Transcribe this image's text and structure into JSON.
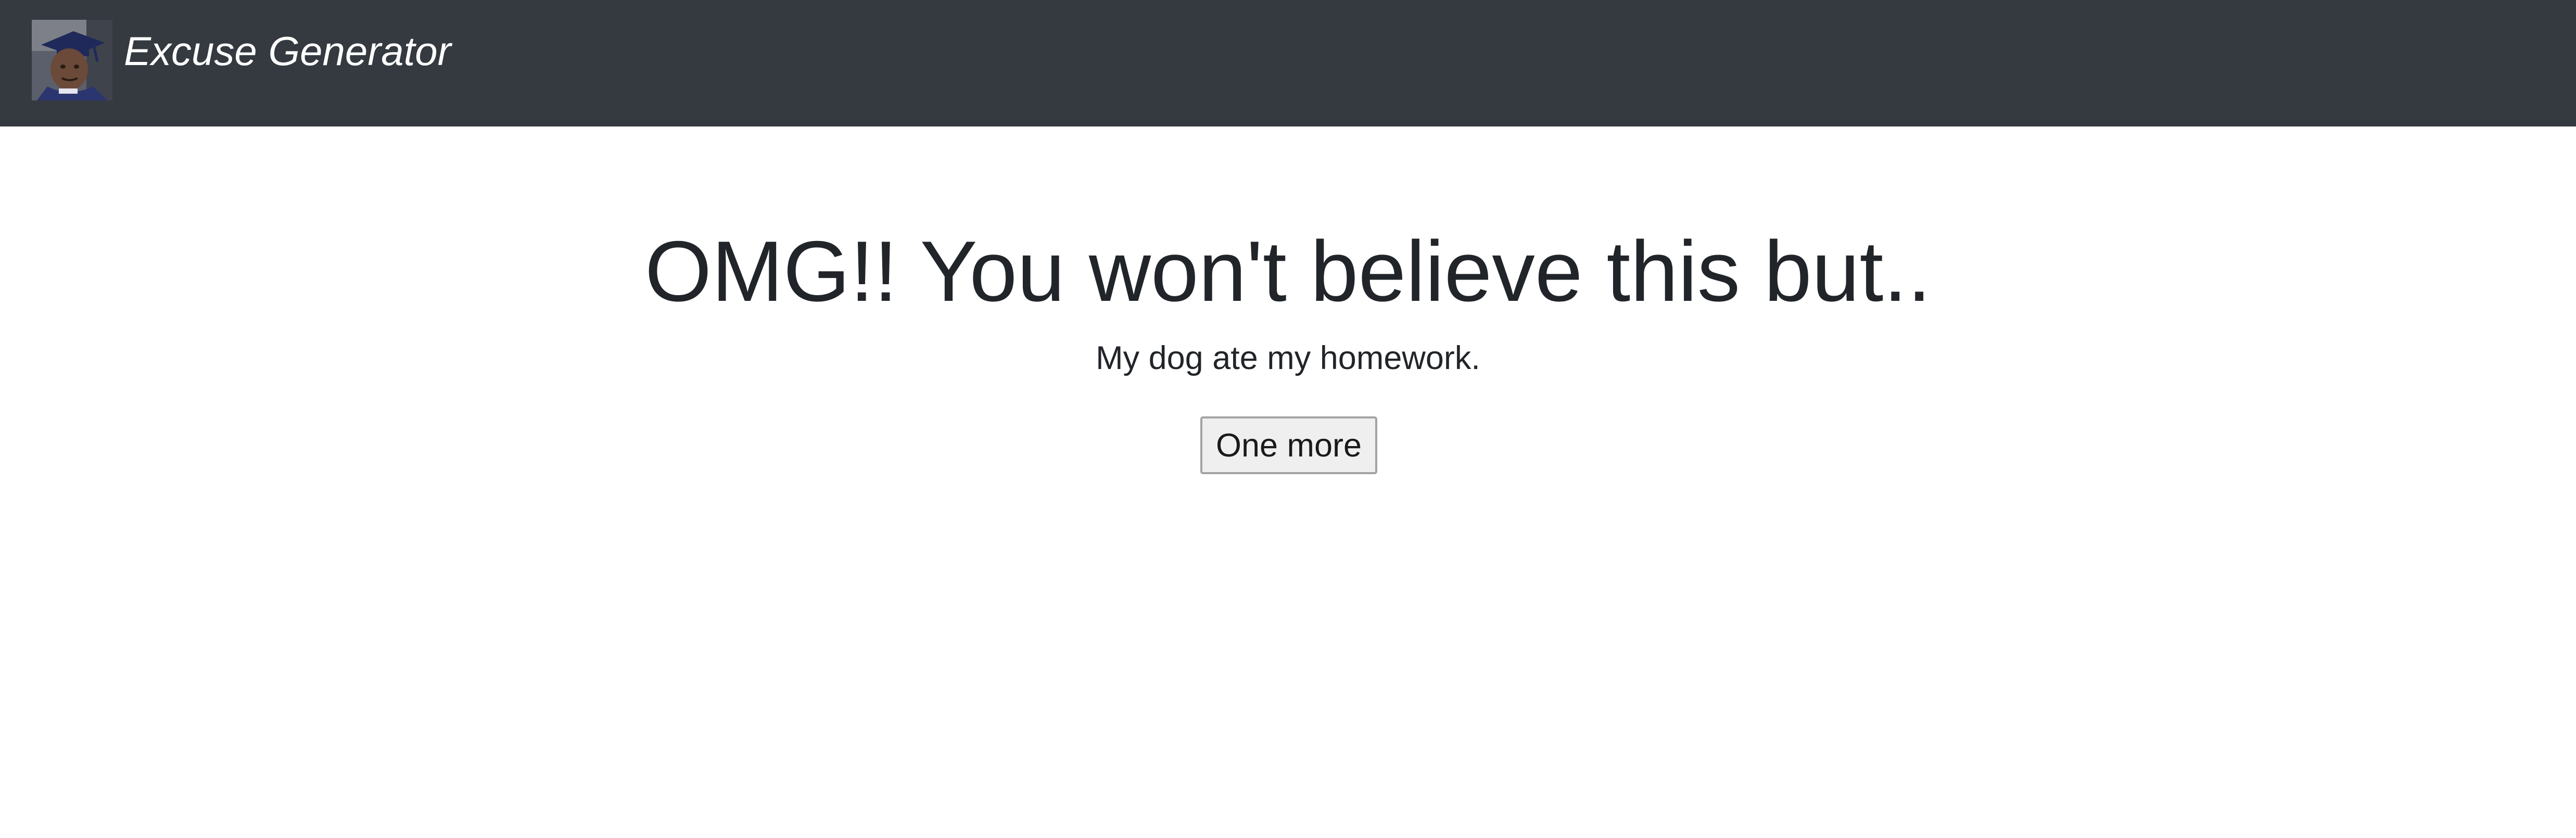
{
  "navbar": {
    "brand_name": "Excuse Generator",
    "logo_alt": "graduate-avatar",
    "background_color": "#343a40"
  },
  "main": {
    "headline": "OMG!! You won't believe this but..",
    "excuse": "My dog ate my homework.",
    "button_label": "One more"
  },
  "colors": {
    "text": "#212529",
    "button_bg": "#efefef",
    "button_border": "#a3a3a3"
  }
}
